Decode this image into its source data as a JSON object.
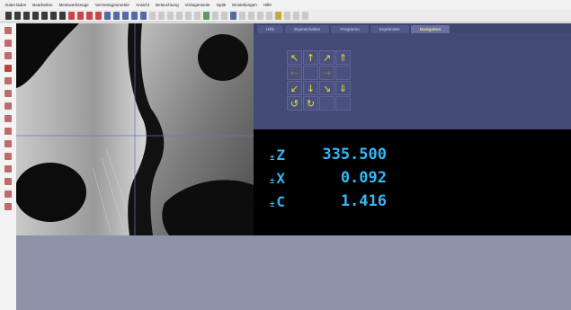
{
  "menu": [
    "Datei laden",
    "Bearbeiten",
    "Messwerkzeuge",
    "Vermessgeometrie",
    "Ansicht",
    "Beleuchtung",
    "Vorlagenseite",
    "Optik",
    "Einstellungen",
    "Hilfe"
  ],
  "tabs": [
    {
      "label": "Hilfe",
      "active": false
    },
    {
      "label": "Eigenschaften",
      "active": false
    },
    {
      "label": "Programm",
      "active": false
    },
    {
      "label": "Ergebnisse",
      "active": false
    },
    {
      "label": "Navigation",
      "active": true
    }
  ],
  "navigation": {
    "arrows": [
      {
        "name": "up-left-arrow",
        "glyph": "↖"
      },
      {
        "name": "up-arrow",
        "glyph": "↑"
      },
      {
        "name": "up-right-arrow",
        "glyph": "↗"
      },
      {
        "name": "z-up-arrow",
        "glyph": "⇑"
      },
      {
        "name": "left-arrow",
        "glyph": "←"
      },
      {
        "name": "center-blank",
        "glyph": ""
      },
      {
        "name": "right-arrow",
        "glyph": "→"
      },
      {
        "name": "blank-right",
        "glyph": ""
      },
      {
        "name": "down-left-arrow",
        "glyph": "↙"
      },
      {
        "name": "down-arrow",
        "glyph": "↓"
      },
      {
        "name": "down-right-arrow",
        "glyph": "↘"
      },
      {
        "name": "z-down-arrow",
        "glyph": "⇓"
      },
      {
        "name": "rotate-ccw-arrow",
        "glyph": "↺"
      },
      {
        "name": "rotate-cw-arrow",
        "glyph": "↻"
      },
      {
        "name": "blank-3",
        "glyph": ""
      },
      {
        "name": "blank-4",
        "glyph": ""
      }
    ],
    "arrow_color": "#e6dd3d"
  },
  "readout": {
    "Z": {
      "axis": "Z",
      "value": "335.500"
    },
    "X": {
      "axis": "X",
      "value": "0.092"
    },
    "C": {
      "axis": "C",
      "value": "1.416"
    },
    "color": "#33b8f5"
  },
  "colors": {
    "panel": "#434a75",
    "tabbar": "#3f456d",
    "bottom": "#8e93a9"
  }
}
